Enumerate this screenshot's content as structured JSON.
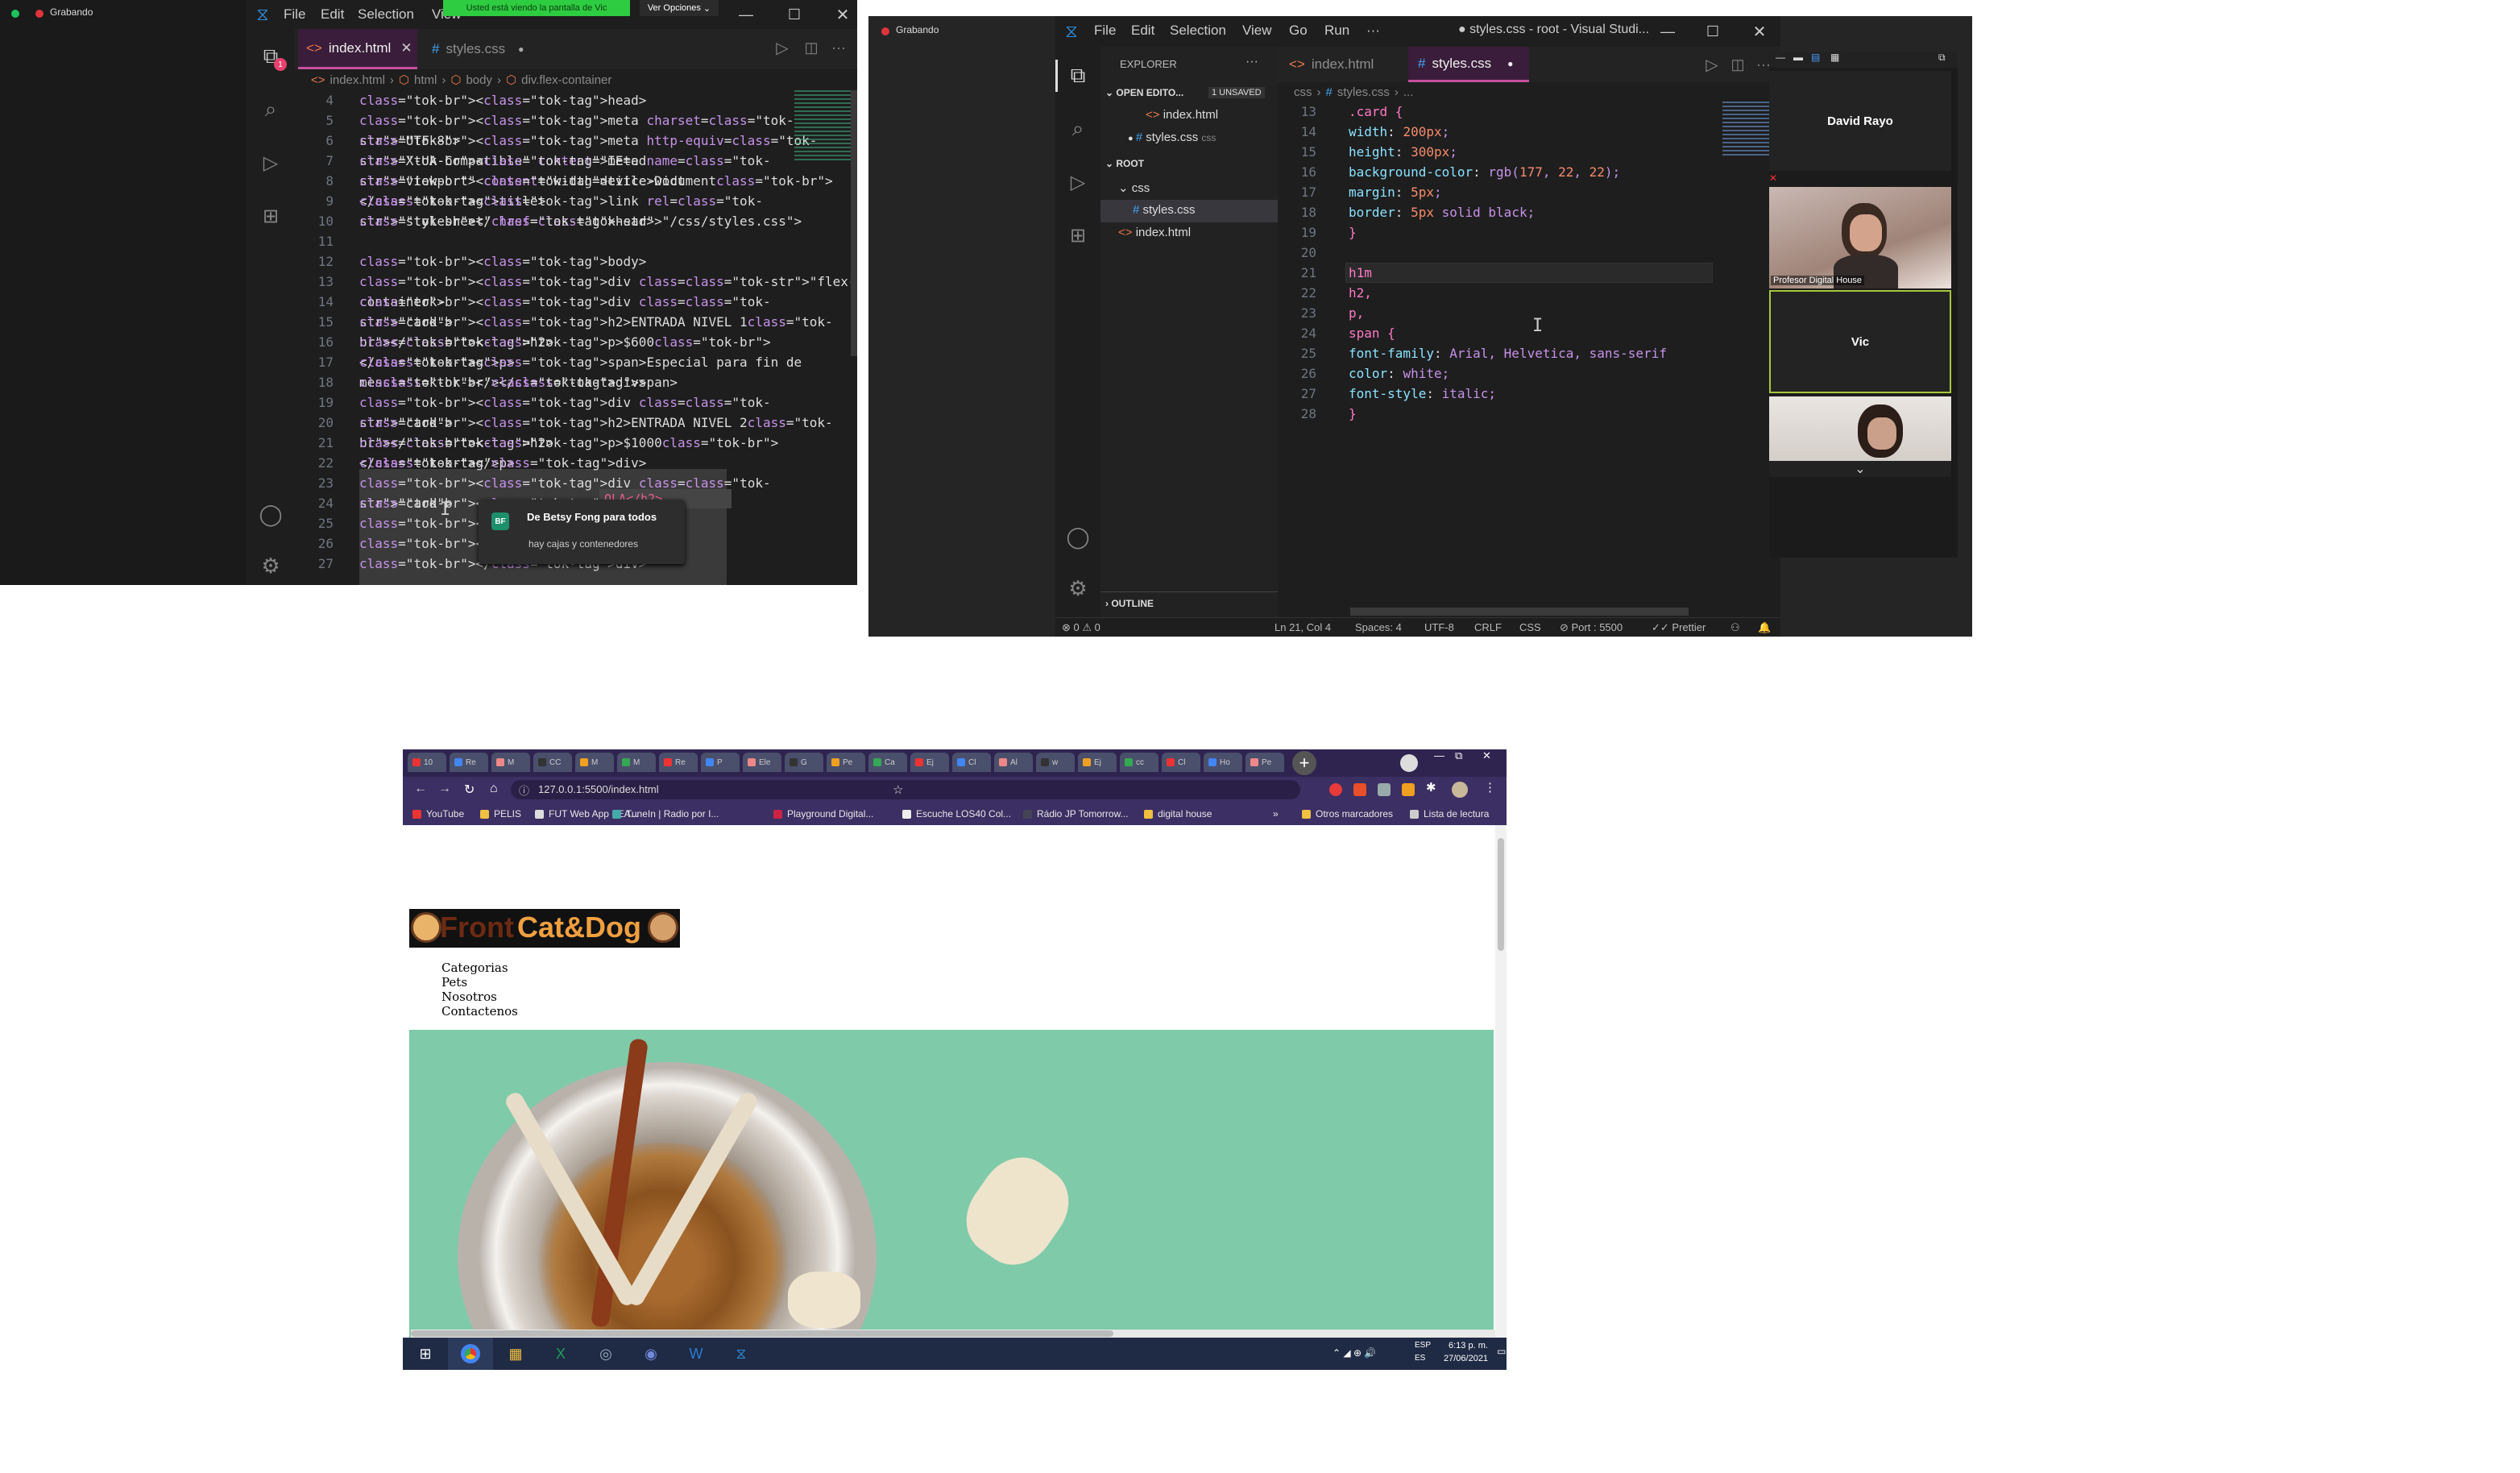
{
  "left_session": {
    "recording_label": "Grabando",
    "share_banner": "Usted está viendo la pantalla de Vic",
    "view_options": "Ver Opciones",
    "menu": [
      "File",
      "Edit",
      "Selection",
      "View"
    ],
    "tabs": [
      {
        "label": "index.html"
      },
      {
        "label": "styles.css"
      }
    ],
    "breadcrumb": [
      "index.html",
      "html",
      "body",
      "div.flex-container"
    ],
    "line_numbers": [
      "4",
      "5",
      "6",
      "7",
      "8",
      "9",
      "10",
      "11",
      "12",
      "13",
      "14",
      "15",
      "16",
      "17",
      "18",
      "19",
      "20",
      "21",
      "22",
      "23",
      "24",
      "25",
      "26",
      "27"
    ],
    "code": [
      "    <head>",
      "        <meta charset=\"UTF-8\">",
      "        <meta http-equiv=\"X-UA-Compatible\" content=\"IE=ed",
      "        <meta name=\"viewport\" content=\"width=device-widt",
      "        <title>Document</title>",
      "        <link rel=\"stylesheet\" href=\"/css/styles.css\">",
      "    </head>",
      "",
      "    <body>",
      "        <div class=\"flex-container\">",
      "            <div class=\"card\">",
      "                <h2>ENTRADA NIVEL 1</h2>",
      "                <p>$600</p>",
      "                <span>Especial para fin de mes</span>",
      "            </div>",
      "            <div class=\"card\">",
      "                <h2>ENTRADA NIVEL 2</h2>",
      "                <p>$1000</p>",
      "            </div>",
      "            <div class=\"card\">",
      "                <h",
      "                <p",
      "            </div>",
      "        </div>"
    ],
    "hover_fragment": "OLA</h2>",
    "chat": {
      "avatar": "BF",
      "from": "De Betsy Fong para todos",
      "message": "hay cajas y contenedores"
    }
  },
  "right_session": {
    "recording_label": "Grabando",
    "menu": [
      "File",
      "Edit",
      "Selection",
      "View",
      "Go",
      "Run",
      "···"
    ],
    "window_title": "● styles.css - root - Visual Studi...",
    "explorer": {
      "title": "EXPLORER",
      "open_editors": "OPEN EDITO...",
      "unsaved": "1 UNSAVED",
      "open_files": [
        "index.html",
        "styles.css"
      ],
      "open_file_lang": "css",
      "root": "ROOT",
      "folder": "css",
      "tree_files": [
        "styles.css",
        "index.html"
      ],
      "outline": "OUTLINE"
    },
    "tabs": [
      {
        "label": "index.html"
      },
      {
        "label": "styles.css"
      }
    ],
    "breadcrumb": [
      "css",
      "styles.css",
      "..."
    ],
    "line_numbers": [
      "13",
      "14",
      "15",
      "16",
      "17",
      "18",
      "19",
      "20",
      "21",
      "22",
      "23",
      "24",
      "25",
      "26",
      "27",
      "28"
    ],
    "code": [
      ".card {",
      "    width: 200px;",
      "    height: 300px;",
      "    background-color: rgb(177, 22, 22);",
      "    margin: 5px;",
      "    border: 5px solid black;",
      "}",
      "",
      "h1m",
      "h2,",
      "p,",
      "span {",
      "    font-family: Arial, Helvetica, sans-serif",
      "    color: white;",
      "    font-style: italic;",
      "}"
    ],
    "status": {
      "problems": "⊗ 0 ⚠ 0",
      "position": "Ln 21, Col 4",
      "spaces": "Spaces: 4",
      "encoding": "UTF-8",
      "eol": "CRLF",
      "language": "CSS",
      "port": "Port : 5500",
      "prettier": "Prettier"
    },
    "colors": {
      "bg_red": "#b11616",
      "accent_tab": "#a033a0"
    },
    "participants": [
      {
        "name": "David Rayo"
      },
      {
        "name": "Profesor Digital House"
      },
      {
        "name": "Vic"
      },
      {
        "name": ""
      }
    ]
  },
  "browser": {
    "url": "127.0.0.1:5500/index.html",
    "tabs": [
      "10",
      "Re",
      "M",
      "CC",
      "M",
      "M",
      "Re",
      "P",
      "Ele",
      "G",
      "Pe",
      "Ca",
      "Ej",
      "Cl",
      "Al",
      "w",
      "Ej",
      "cc",
      "Cl",
      "Ho",
      "Pe"
    ],
    "bookmarks": [
      "YouTube",
      "PELIS",
      "FUT Web App - EA...",
      "TuneIn | Radio por I...",
      "Playground Digital...",
      "Escuche LOS40 Col...",
      "Rádio JP Tomorrow...",
      "digital house",
      "»",
      "Otros marcadores",
      "Lista de lectura"
    ],
    "page": {
      "logo_front": "Front",
      "logo_brand": "Cat&Dog",
      "nav": [
        "Categorias",
        "Pets",
        "Nosotros",
        "Contactenos"
      ]
    },
    "taskbar": {
      "lang": "ESP",
      "lang2": "ES",
      "time": "6:13 p. m.",
      "date": "27/06/2021"
    }
  }
}
